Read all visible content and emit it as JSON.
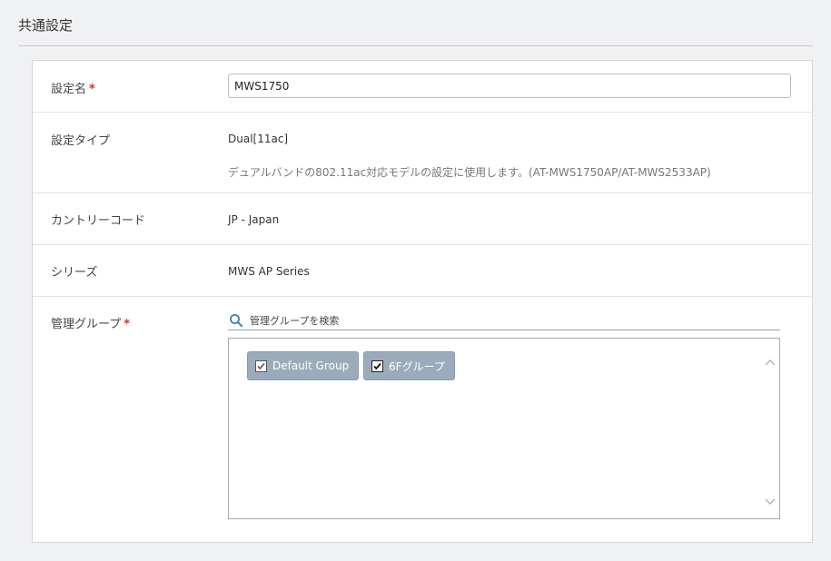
{
  "section": {
    "title": "共通設定"
  },
  "form": {
    "name": {
      "label": "設定名",
      "required_mark": "*",
      "value": "MWS1750"
    },
    "type": {
      "label": "設定タイプ",
      "value": "Dual[11ac]",
      "description": "デュアルバンドの802.11ac対応モデルの設定に使用します。(AT-MWS1750AP/AT-MWS2533AP)"
    },
    "country": {
      "label": "カントリーコード",
      "value": "JP - Japan"
    },
    "series": {
      "label": "シリーズ",
      "value": "MWS AP Series"
    },
    "group": {
      "label": "管理グループ",
      "required_mark": "*",
      "search_placeholder": "管理グループを検索",
      "items": [
        {
          "label": "Default Group",
          "checked": true
        },
        {
          "label": "6Fグループ",
          "checked": true
        }
      ]
    }
  },
  "colors": {
    "required": "#d0312d",
    "chip_bg": "#9aabbc",
    "search_underline": "#8aa3b5"
  }
}
